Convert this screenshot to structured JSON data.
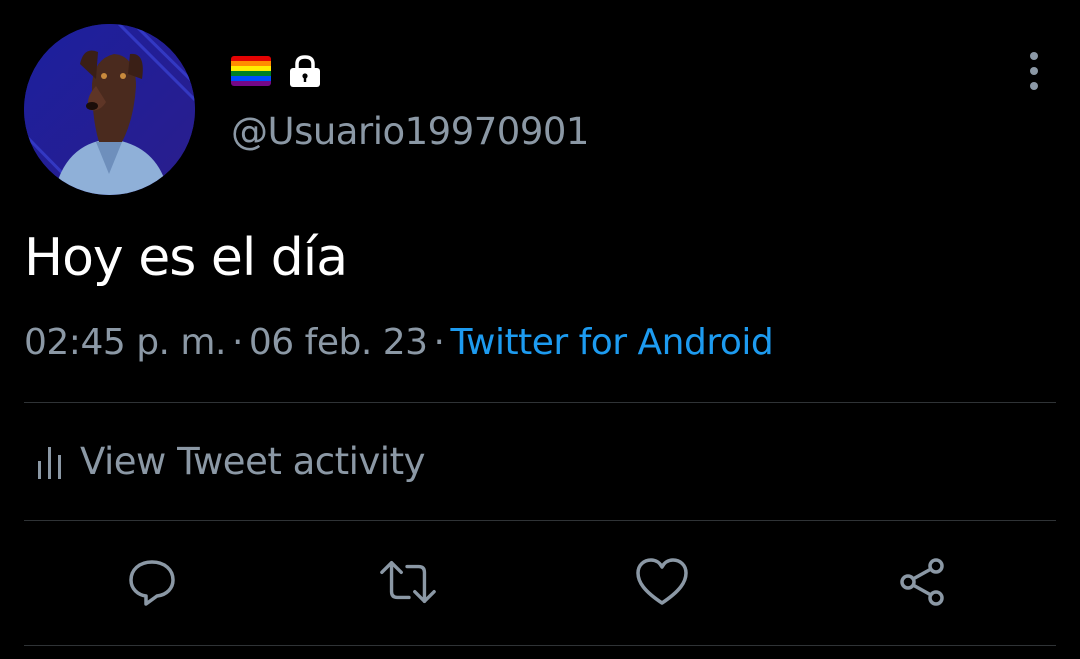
{
  "profile": {
    "handle": "@Usuario19970901",
    "flag_colors": [
      "#e40303",
      "#ff8c00",
      "#ffed00",
      "#008026",
      "#004dff",
      "#750787"
    ]
  },
  "tweet": {
    "text": "Hoy es el día",
    "time": "02:45 p. m.",
    "separator": "·",
    "date": "06 feb. 23",
    "source": "Twitter for Android"
  },
  "activity": {
    "label": "View Tweet activity"
  },
  "icons": {
    "more": "more-vertical-icon",
    "lock": "lock-icon",
    "stats": "bar-chart-icon",
    "reply": "reply-icon",
    "retweet": "retweet-icon",
    "like": "heart-icon",
    "share": "share-icon"
  },
  "colors": {
    "background": "#000000",
    "text": "#ffffff",
    "secondary": "#8b98a5",
    "link": "#1d9bf0",
    "divider": "#2f3336"
  }
}
